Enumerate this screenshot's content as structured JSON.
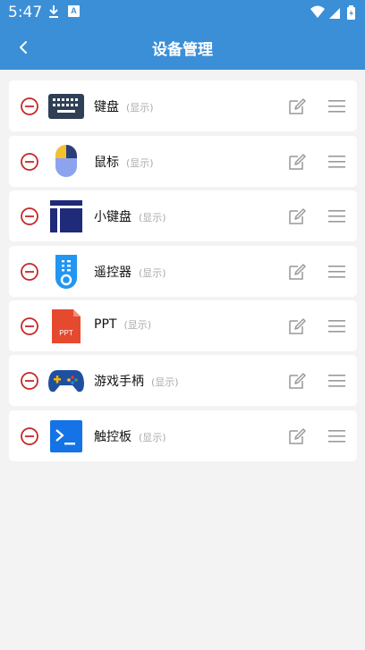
{
  "status_bar": {
    "time": "5:47",
    "download_icon": "download-icon",
    "a_badge": "A",
    "wifi_icon": "wifi-icon",
    "signal_icon": "signal-icon",
    "battery_icon": "battery-icon"
  },
  "app_bar": {
    "title": "设备管理",
    "back_icon": "chevron-left-icon"
  },
  "devices": [
    {
      "name": "键盘",
      "status": "(显示)",
      "icon": "keyboard-icon"
    },
    {
      "name": "鼠标",
      "status": "(显示)",
      "icon": "mouse-icon"
    },
    {
      "name": "小键盘",
      "status": "(显示)",
      "icon": "numpad-icon"
    },
    {
      "name": "遥控器",
      "status": "(显示)",
      "icon": "remote-icon"
    },
    {
      "name": "PPT",
      "status": "(显示)",
      "icon": "ppt-icon",
      "icon_text": "PPT"
    },
    {
      "name": "游戏手柄",
      "status": "(显示)",
      "icon": "gamepad-icon"
    },
    {
      "name": "触控板",
      "status": "(显示)",
      "icon": "touchpad-icon"
    }
  ],
  "colors": {
    "primary": "#3b8fd6",
    "remove": "#c62828",
    "navy": "#1f2a78",
    "ppt": "#e64a2e",
    "touchpad": "#1473e6",
    "remote": "#2196f3"
  }
}
